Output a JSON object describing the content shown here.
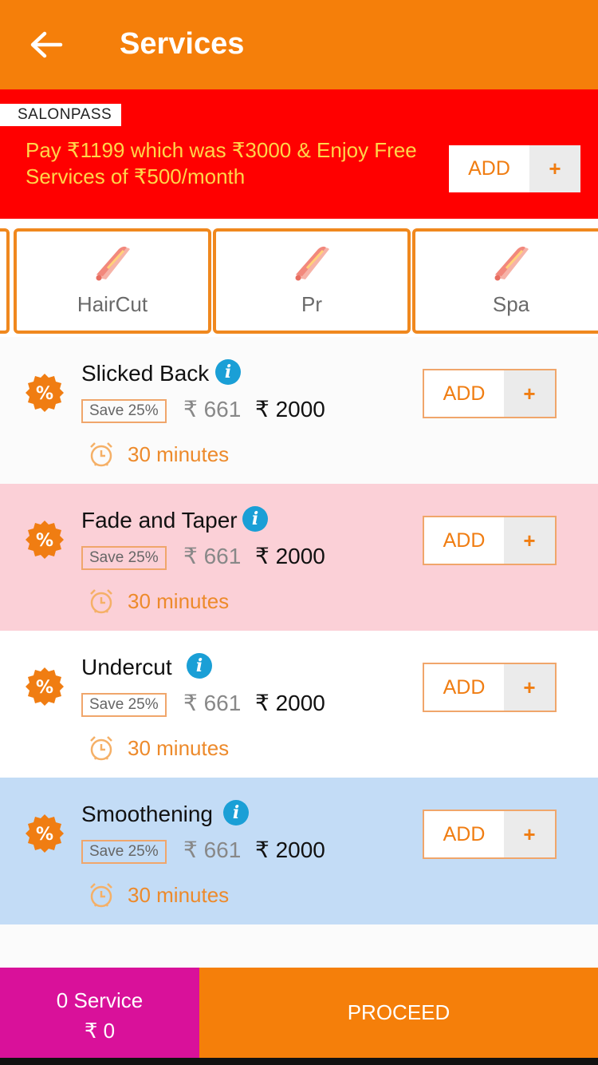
{
  "header": {
    "title": "Services",
    "back_icon": "arrow-left-icon"
  },
  "promo": {
    "tag": "SALONPASS",
    "text": "Pay ₹1199 which was ₹3000 & Enjoy Free Services of ₹500/month",
    "add_label": "ADD",
    "plus": "+"
  },
  "categories": [
    {
      "name": "HairCut",
      "icon": "hair-straightener-icon"
    },
    {
      "name": "Pr",
      "icon": "hair-straightener-icon"
    },
    {
      "name": "Spa",
      "icon": "hair-straightener-icon"
    }
  ],
  "services": [
    {
      "name": "Slicked Back",
      "save": "Save 25%",
      "price_old": "₹ 661",
      "price_new": "₹ 2000",
      "duration": "30 minutes",
      "add_label": "ADD",
      "plus": "+",
      "bg": "#ffffff"
    },
    {
      "name": "Fade and Taper",
      "save": "Save 25%",
      "price_old": "₹ 661",
      "price_new": "₹ 2000",
      "duration": "30 minutes",
      "add_label": "ADD",
      "plus": "+",
      "bg": "#fbd0d7"
    },
    {
      "name": "Undercut",
      "save": "Save 25%",
      "price_old": "₹ 661",
      "price_new": "₹ 2000",
      "duration": "30 minutes",
      "add_label": "ADD",
      "plus": "+",
      "bg": "#ffffff"
    },
    {
      "name": "Smoothening",
      "save": "Save 25%",
      "price_old": "₹ 661",
      "price_new": "₹ 2000",
      "duration": "30 minutes",
      "add_label": "ADD",
      "plus": "+",
      "bg": "#c3dcf6"
    }
  ],
  "footer": {
    "count": "0 Service",
    "total": "₹ 0",
    "proceed": "PROCEED"
  },
  "colors": {
    "brand": "#f57f0a",
    "promo_bg": "#ff0000",
    "footer_left_bg": "#d9119a",
    "info": "#1a9fd6"
  }
}
